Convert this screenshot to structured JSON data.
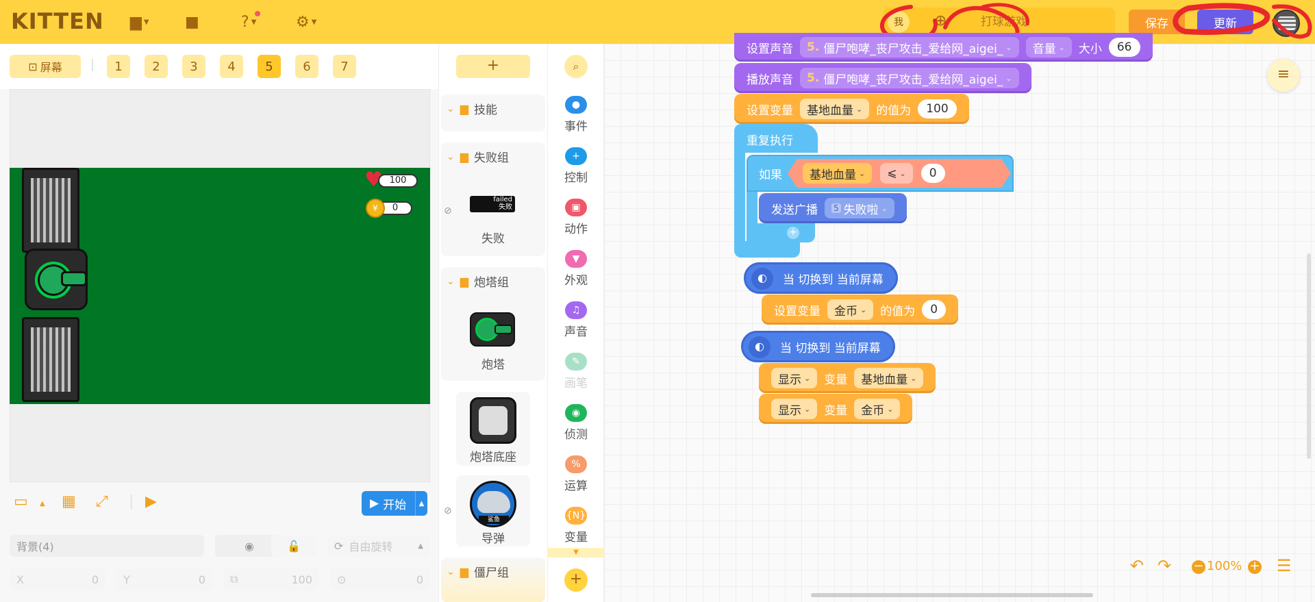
{
  "app": {
    "logo": "KITTEN"
  },
  "topbar": {
    "me_label": "我",
    "team_placeholder": "打球游戏",
    "save_label": "保存",
    "update_label": "更新"
  },
  "screens": {
    "screen_label": "屏幕",
    "tabs": [
      "1",
      "2",
      "3",
      "4",
      "5",
      "6",
      "7"
    ],
    "active_tab": "5"
  },
  "stage": {
    "hp_value": "100",
    "coin_value": "0",
    "coin_symbol": "¥",
    "start_label": "开始"
  },
  "properties": {
    "name_value": "背景(4)",
    "rotation_label": "自由旋转",
    "x_label": "X",
    "x_value": "0",
    "y_label": "Y",
    "y_value": "0",
    "size_value": "100",
    "dir_value": "0"
  },
  "sprites": {
    "add_label": "+",
    "groups": [
      {
        "name": "技能"
      },
      {
        "name": "失败组",
        "sprite": "失败"
      },
      {
        "name": "炮塔组",
        "sprite": "炮塔"
      }
    ],
    "loose": [
      "炮塔底座",
      "导弹"
    ],
    "last_group": "僵尸组",
    "failed_text": "failed",
    "failed_sub": "失败",
    "missile_badge": "鲨鱼"
  },
  "categories": [
    {
      "label": "事件",
      "color": "#2b8fea",
      "icon": "●"
    },
    {
      "label": "控制",
      "color": "#1e9be8",
      "icon": "+"
    },
    {
      "label": "动作",
      "color": "#f0586a",
      "icon": "▣"
    },
    {
      "label": "外观",
      "color": "#f06bb0",
      "icon": "▼"
    },
    {
      "label": "声音",
      "color": "#a368f0",
      "icon": "♫"
    },
    {
      "label": "画笔",
      "color": "#a7e0c6",
      "icon": "✎"
    },
    {
      "label": "侦测",
      "color": "#1fb55a",
      "icon": "◉"
    },
    {
      "label": "运算",
      "color": "#f89b6c",
      "icon": "%"
    },
    {
      "label": "变量",
      "color": "#ffb13c",
      "icon": "{N}"
    }
  ],
  "code": {
    "b1": {
      "label": "设置声音",
      "sound_num": "5.",
      "sound": "僵尸咆哮_丧尸攻击_爱给网_aigei_",
      "vol": "音量",
      "size": "大小",
      "value": "66"
    },
    "b2": {
      "label": "播放声音",
      "sound_num": "5.",
      "sound": "僵尸咆哮_丧尸攻击_爱给网_aigei_"
    },
    "b3": {
      "label": "设置变量",
      "var": "基地血量",
      "to": "的值为",
      "value": "100"
    },
    "loop": {
      "label": "重复执行"
    },
    "if": {
      "label": "如果",
      "var": "基地血量",
      "op": "⩽",
      "value": "0"
    },
    "broadcast": {
      "label": "发送广播",
      "num": "5",
      "msg": "失败啦"
    },
    "hat1": {
      "label": "当 切换到 当前屏幕"
    },
    "b4": {
      "label": "设置变量",
      "var": "金币",
      "to": "的值为",
      "value": "0"
    },
    "hat2": {
      "label": "当 切换到 当前屏幕"
    },
    "show1": {
      "action": "显示",
      "word": "变量",
      "var": "基地血量"
    },
    "show2": {
      "action": "显示",
      "word": "变量",
      "var": "金币"
    }
  },
  "canvas": {
    "zoom": "100%"
  },
  "colors": {
    "brand": "#ffd23f",
    "save": "#f89b2c",
    "update": "#6b5ce7",
    "stage": "#017624"
  }
}
